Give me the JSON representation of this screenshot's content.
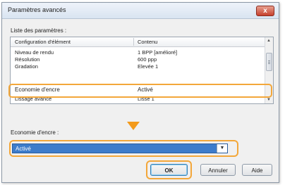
{
  "window": {
    "title": "Paramètres avancés",
    "close_glyph": "x"
  },
  "settings_list": {
    "label": "Liste des paramètres :",
    "columns": [
      "Configuration d'élément",
      "Contenu"
    ],
    "rows": [
      {
        "item": "Niveau de rendu",
        "value": "1 BPP [amélioré]"
      },
      {
        "item": "Résolution",
        "value": "600 ppp"
      },
      {
        "item": "Gradation",
        "value": "Elevée 1"
      },
      {
        "item": "Economie d'encre",
        "value": "Activé",
        "selected": true
      },
      {
        "item": "Lissage avancé",
        "value": "Lisse 1"
      }
    ]
  },
  "ink_saving": {
    "label": "Economie d'encre :",
    "selected_value": "Activé"
  },
  "buttons": {
    "ok": "OK",
    "cancel": "Annuler",
    "help": "Aide"
  },
  "colors": {
    "highlight": "#f3a73a",
    "selection": "#3d7ccb"
  }
}
